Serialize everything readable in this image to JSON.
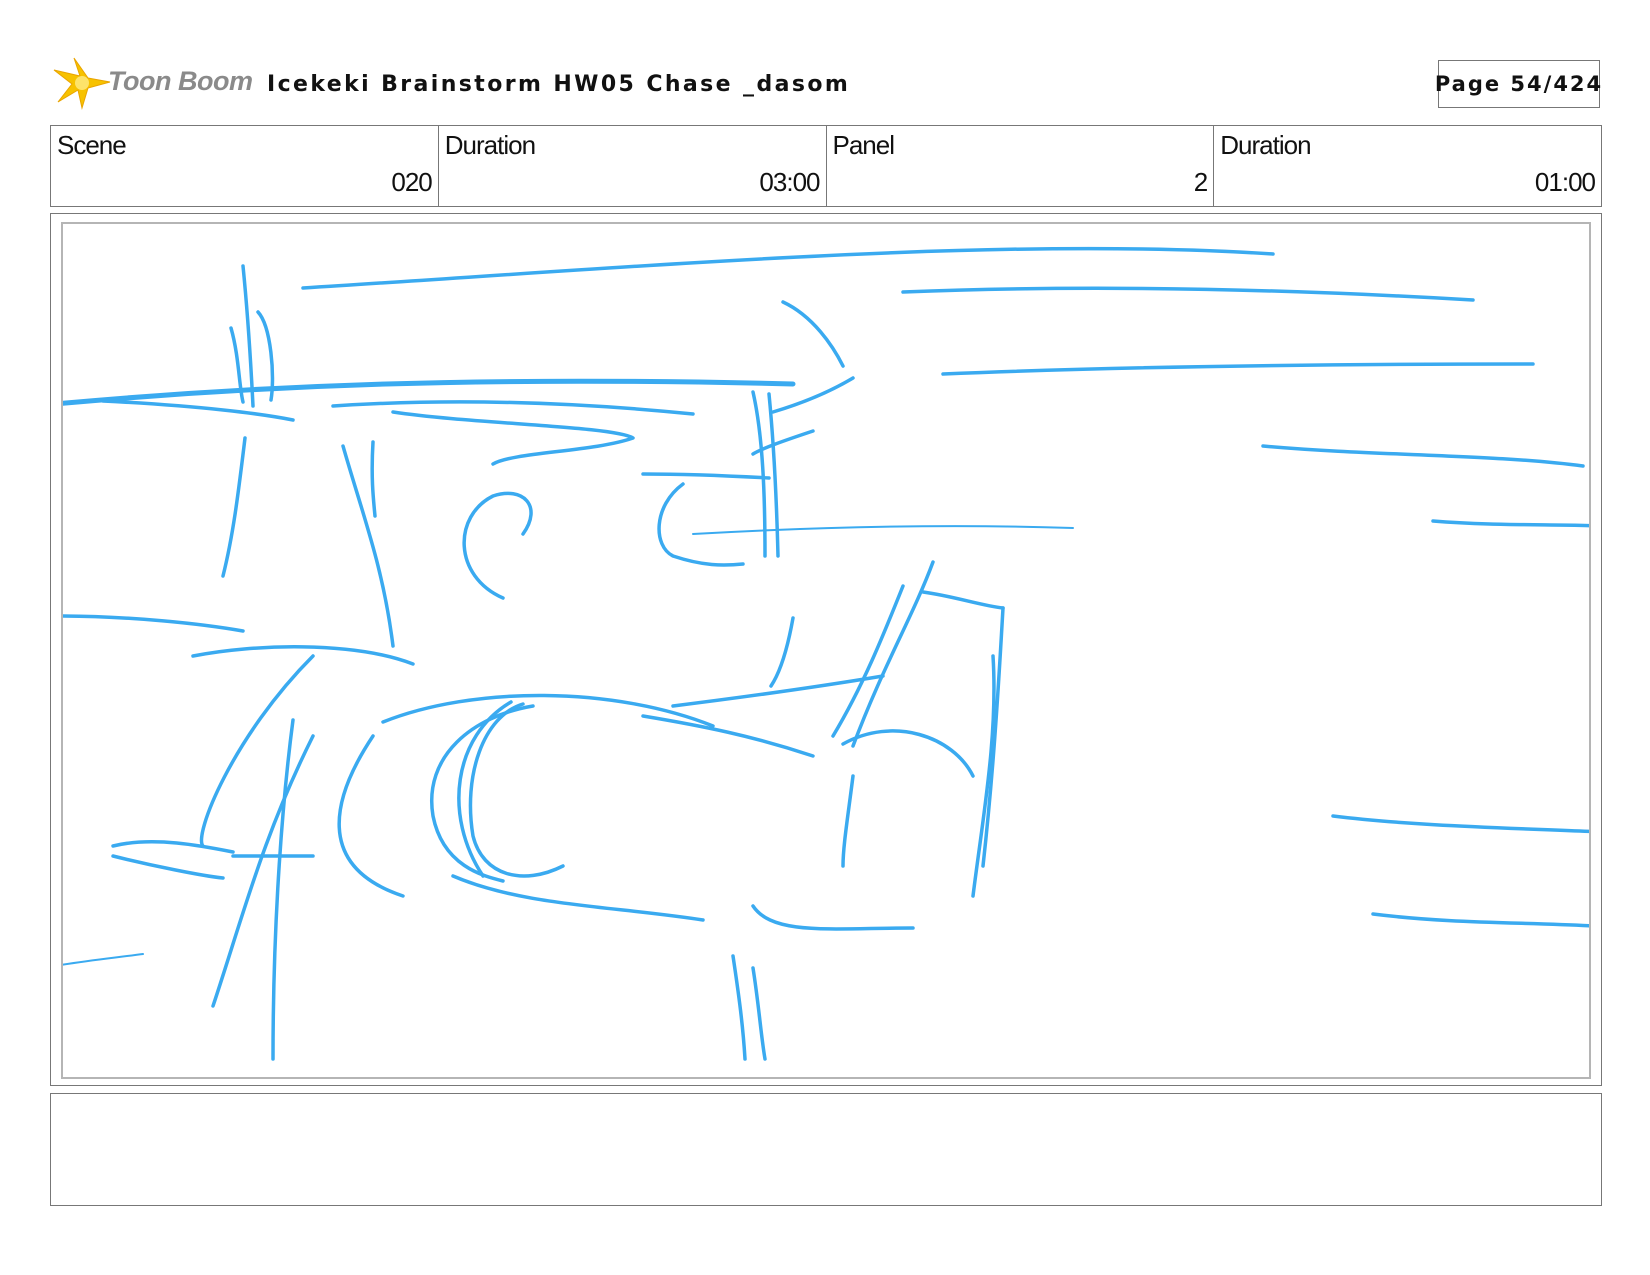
{
  "header": {
    "logo_text": "Toon Boom",
    "title": "Icekeki Brainstorm HW05 Chase _dasom",
    "page_label": "Page 54/424"
  },
  "info": {
    "scene_label": "Scene",
    "scene_value": "020",
    "scene_duration_label": "Duration",
    "scene_duration_value": "03:00",
    "panel_label": "Panel",
    "panel_value": "2",
    "panel_duration_label": "Duration",
    "panel_duration_value": "01:00"
  },
  "panel": {
    "sketch_icon": "rough-sketch-drawing",
    "sketch_color": "#3aaaf0"
  },
  "notes": {
    "text": ""
  },
  "colors": {
    "border": "#777777",
    "logo_star": "#f5b400",
    "logo_text": "#8a8a8a"
  }
}
